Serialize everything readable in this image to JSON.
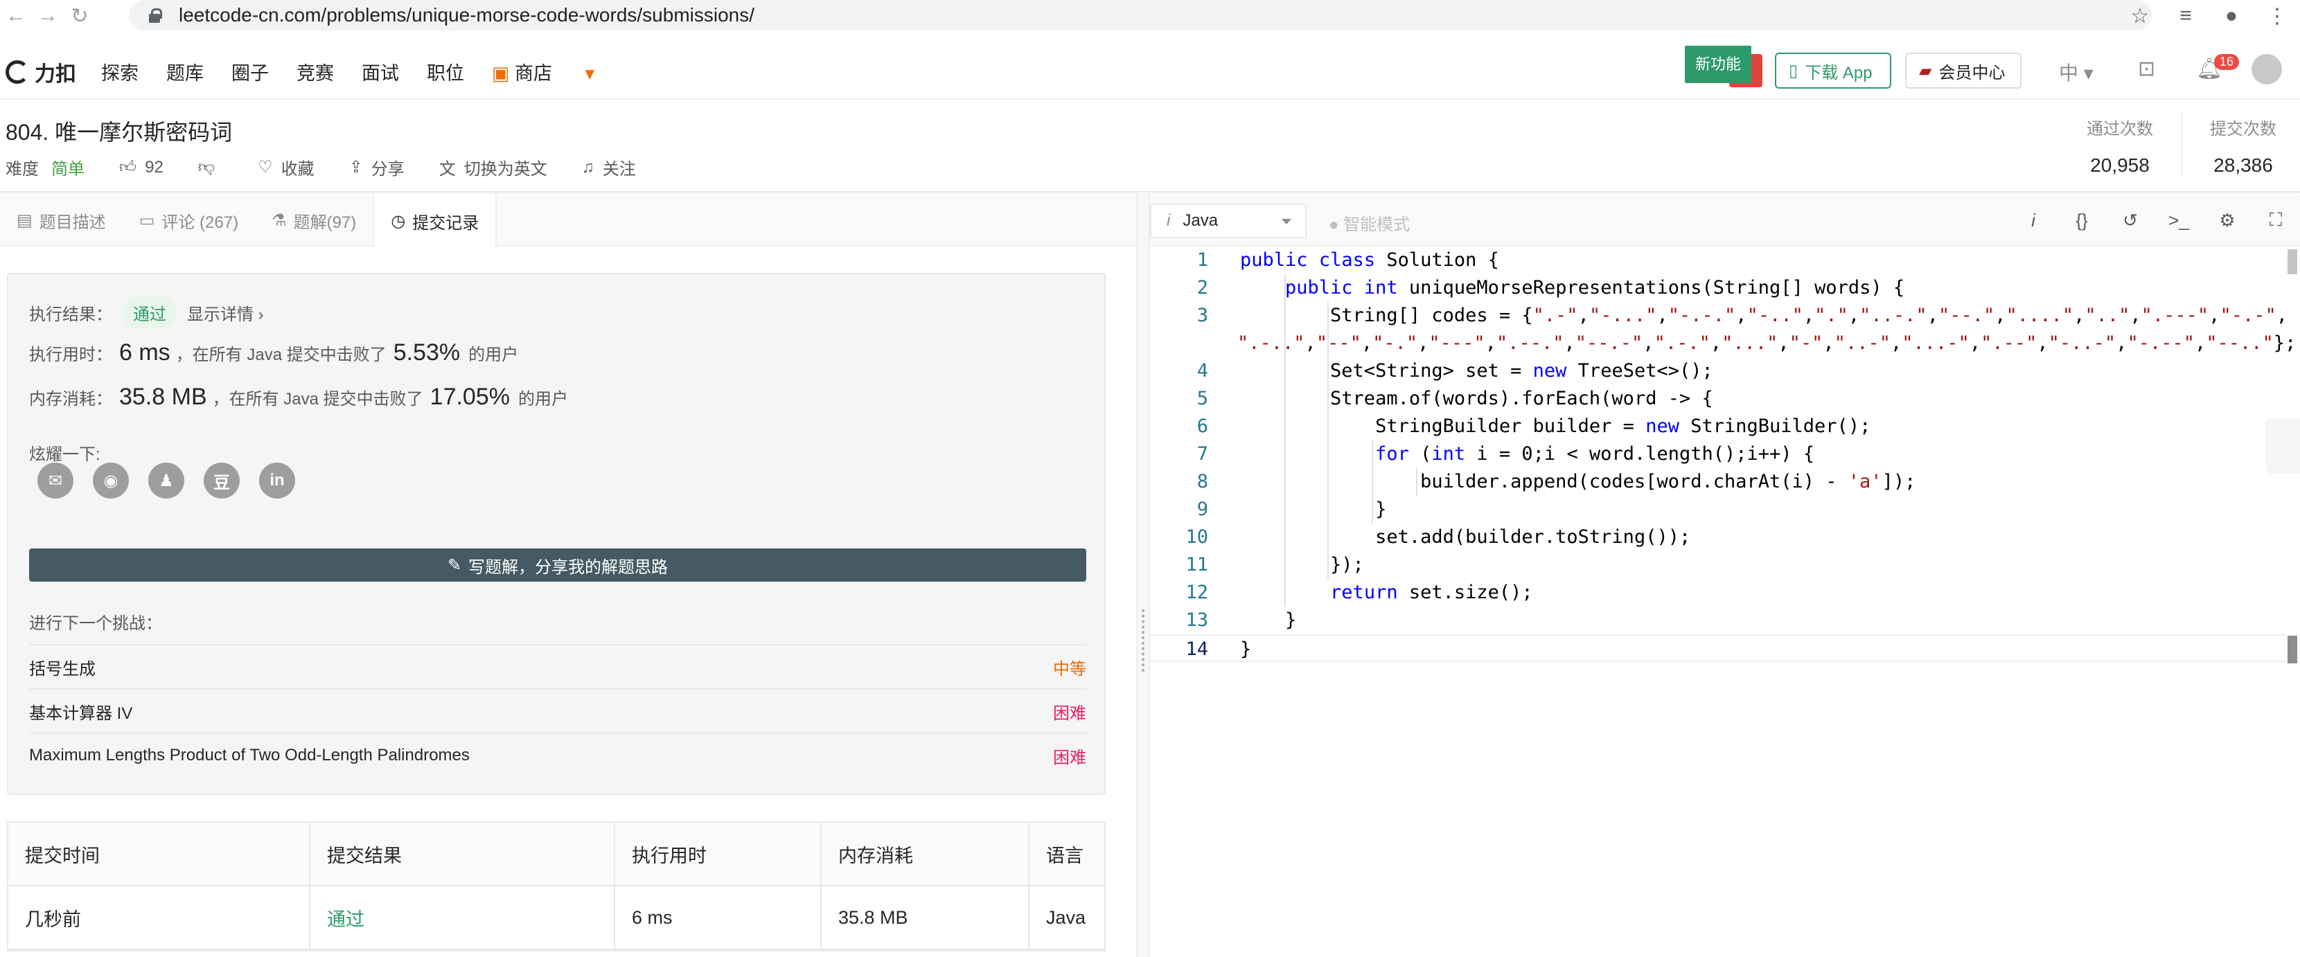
{
  "browser": {
    "url": "leetcode-cn.com/problems/unique-morse-code-words/submissions/"
  },
  "header": {
    "logo": "力扣",
    "nav": [
      "探索",
      "题库",
      "圈子",
      "竞赛",
      "面试",
      "职位",
      "商店"
    ],
    "new_feature": "新功能",
    "download_app": "下载 App",
    "member_center": "会员中心",
    "language": "中",
    "notification_count": "16"
  },
  "problem": {
    "title": "804. 唯一摩尔斯密码词",
    "difficulty_label": "难度",
    "difficulty": "简单",
    "likes": "92",
    "favorite": "收藏",
    "share": "分享",
    "switch_lang": "切换为英文",
    "follow": "关注",
    "accepted_label": "通过次数",
    "accepted_count": "20,958",
    "submit_label": "提交次数",
    "submit_count": "28,386"
  },
  "tabs": {
    "description": "题目描述",
    "comments": "评论 (267)",
    "solutions": "题解(97)",
    "submissions": "提交记录"
  },
  "result": {
    "result_label": "执行结果：",
    "status": "通过",
    "show_detail": "显示详情 ›",
    "runtime_label": "执行用时：",
    "runtime": "6 ms",
    "runtime_mid": "，在所有 Java 提交中击败了",
    "runtime_pct": "5.53%",
    "users_suffix": "的用户",
    "memory_label": "内存消耗：",
    "memory": "35.8 MB",
    "memory_mid": "，在所有 Java 提交中击败了",
    "memory_pct": "17.05%",
    "show_off": "炫耀一下:",
    "write_solution": "写题解，分享我的解题思路",
    "next_challenge": "进行下一个挑战："
  },
  "challenges": [
    {
      "name": "括号生成",
      "level": "中等"
    },
    {
      "name": "基本计算器 IV",
      "level": "困难"
    },
    {
      "name": "Maximum Lengths Product of Two Odd-Length Palindromes",
      "level": "困难"
    }
  ],
  "submissions_table": {
    "headers": [
      "提交时间",
      "提交结果",
      "执行用时",
      "内存消耗",
      "语言"
    ],
    "rows": [
      [
        "几秒前",
        "通过",
        "6 ms",
        "35.8 MB",
        "Java"
      ]
    ]
  },
  "editor": {
    "language": "Java",
    "smart_mode": "智能模式",
    "current_line": "14"
  },
  "code_lines": [
    "1",
    "2",
    "3",
    "4",
    "5",
    "6",
    "7",
    "8",
    "9",
    "10",
    "11",
    "12",
    "13",
    "14"
  ]
}
